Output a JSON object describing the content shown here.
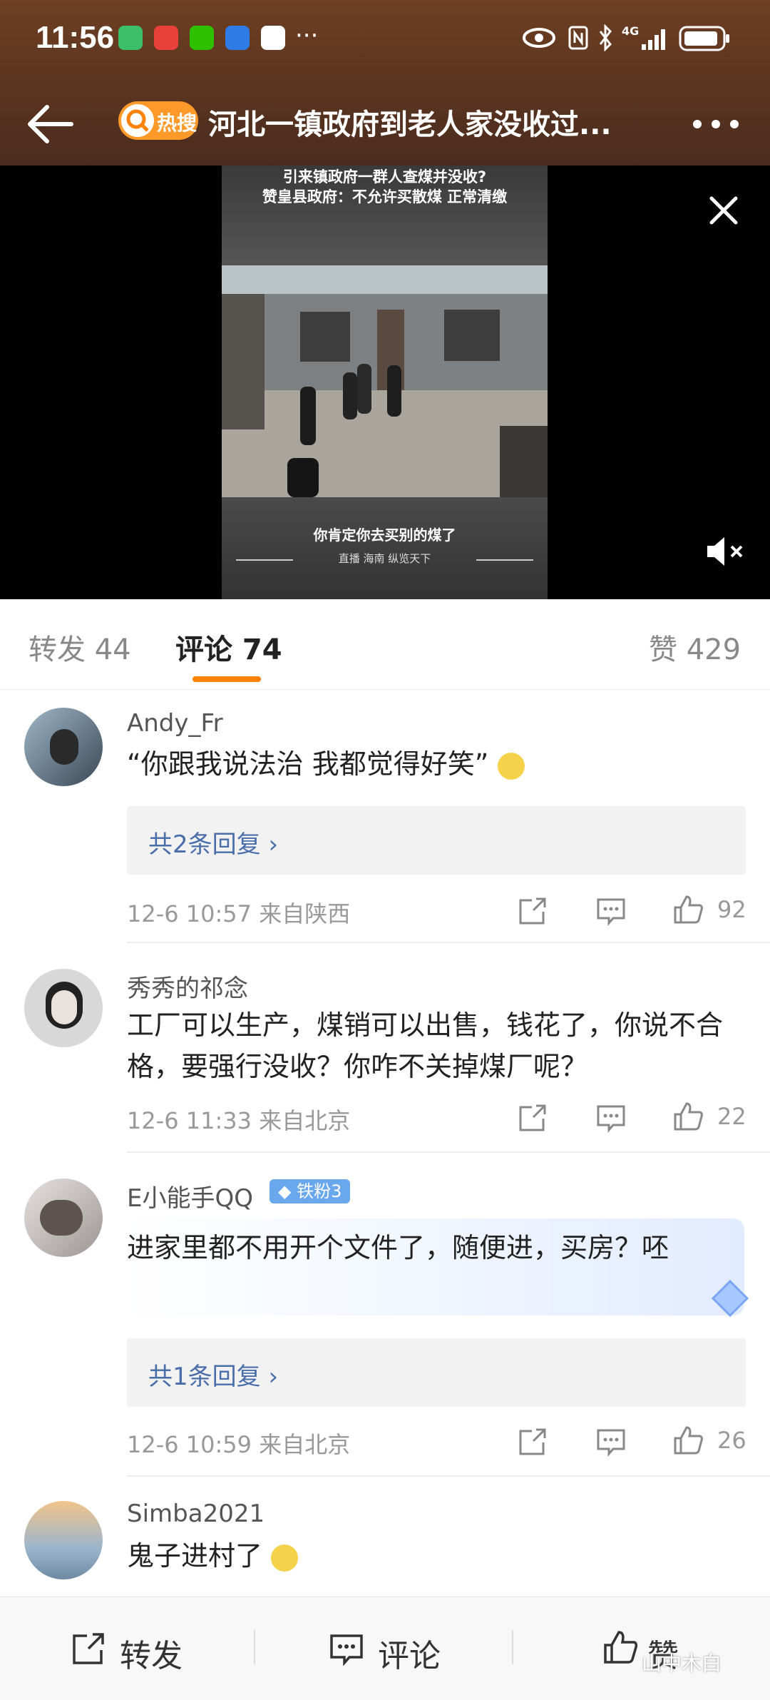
{
  "status_bar": {
    "time": "11:56",
    "network": "4G"
  },
  "nav": {
    "hot_badge": "热搜",
    "title": "河北一镇政府到老人家没收过..."
  },
  "video": {
    "caption_top_1": "引来镇政府一群人查煤并没收?",
    "caption_top_2": "赞皇县政府：不允许买散煤 正常清缴",
    "subtitle": "你肯定你去买别的煤了",
    "footer": "直播 海南 纵览天下"
  },
  "tabs": [
    {
      "label": "转发 44"
    },
    {
      "label": "评论 74"
    },
    {
      "label": "赞 429"
    }
  ],
  "comments": [
    {
      "name": "Andy_Fr",
      "text": "“你跟我说法治 我都觉得好笑”",
      "replies": "共2条回复",
      "time": "12-6 10:57 来自陕西",
      "likes": "92"
    },
    {
      "name": "秀秀的祁念",
      "text": "工厂可以生产，煤销可以出售，钱花了，你说不合格，要强行没收？你咋不关掉煤厂呢？",
      "time": "12-6 11:33 来自北京",
      "likes": "22"
    },
    {
      "name": "E小能手QQ",
      "badge": "铁粉3",
      "text": "进家里都不用开个文件了，随便进，买房？呸",
      "replies": "共1条回复",
      "time": "12-6 10:59 来自北京",
      "likes": "26"
    },
    {
      "name": "Simba2021",
      "text": "鬼子进村了"
    }
  ],
  "bottom_bar": {
    "repost": "转发",
    "comment": "评论",
    "like": "赞"
  },
  "watermark": "山中木白",
  "colors": {
    "accent": "#ff8200",
    "link": "#4a6ea9",
    "header_bg": "#5a3420"
  }
}
